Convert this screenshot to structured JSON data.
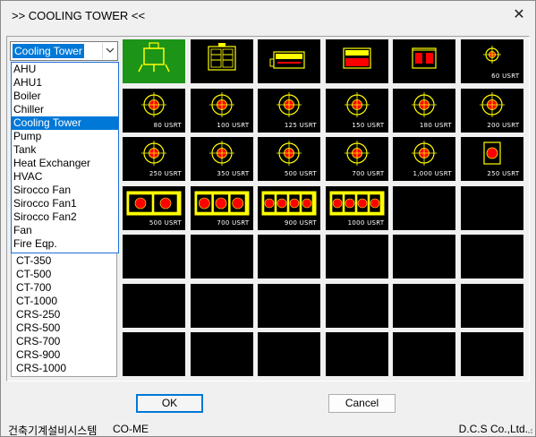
{
  "window": {
    "title": ">> COOLING TOWER <<"
  },
  "combo": {
    "selected": "Cooling Tower"
  },
  "dropdown": {
    "items": [
      "AHU",
      "AHU1",
      "Boiler",
      "Chiller",
      "Cooling Tower",
      "Pump",
      "Tank",
      "Heat Exchanger",
      "HVAC",
      "Sirocco Fan",
      "Sirocco Fan1",
      "Sirocco Fan2",
      "Fan",
      "Fire Eqp."
    ],
    "selected_index": 4
  },
  "list": {
    "items": [
      "CT-350",
      "CT-500",
      "CT-700",
      "CT-1000",
      "CRS-250",
      "CRS-500",
      "CRS-700",
      "CRS-900",
      "CRS-1000"
    ]
  },
  "grid": {
    "rows": [
      [
        {
          "icon": "cooling-tower-top-icon",
          "label": "",
          "highlight": true
        },
        {
          "icon": "cooling-tower-front-icon",
          "label": ""
        },
        {
          "icon": "cooling-tower-side-icon",
          "label": ""
        },
        {
          "icon": "cooling-tower-box-icon",
          "label": ""
        },
        {
          "icon": "cooling-tower-unit-icon",
          "label": ""
        },
        {
          "icon": "round-tower-small-icon",
          "label": "60 USRT"
        }
      ],
      [
        {
          "icon": "round-tower-icon",
          "label": "80 USRT"
        },
        {
          "icon": "round-tower-icon",
          "label": "100 USRT"
        },
        {
          "icon": "round-tower-icon",
          "label": "125 USRT"
        },
        {
          "icon": "round-tower-icon",
          "label": "150 USRT"
        },
        {
          "icon": "round-tower-icon",
          "label": "180 USRT"
        },
        {
          "icon": "round-tower-icon",
          "label": "200 USRT"
        }
      ],
      [
        {
          "icon": "round-tower-icon",
          "label": "250 USRT"
        },
        {
          "icon": "round-tower-icon",
          "label": "350 USRT"
        },
        {
          "icon": "round-tower-icon",
          "label": "500 USRT"
        },
        {
          "icon": "round-tower-icon",
          "label": "700 USRT"
        },
        {
          "icon": "round-tower-icon",
          "label": "1,000 USRT"
        },
        {
          "icon": "square-tower-icon",
          "label": "250 USRT"
        }
      ],
      [
        {
          "icon": "square-tower-multi-icon",
          "label": "500 USRT"
        },
        {
          "icon": "square-tower-multi-icon",
          "label": "700 USRT"
        },
        {
          "icon": "square-tower-multi-icon",
          "label": "900 USRT"
        },
        {
          "icon": "square-tower-multi-icon",
          "label": "1000 USRT"
        },
        {
          "icon": "",
          "label": ""
        },
        {
          "icon": "",
          "label": ""
        }
      ],
      [
        {
          "icon": "",
          "label": ""
        },
        {
          "icon": "",
          "label": ""
        },
        {
          "icon": "",
          "label": ""
        },
        {
          "icon": "",
          "label": ""
        },
        {
          "icon": "",
          "label": ""
        },
        {
          "icon": "",
          "label": ""
        }
      ],
      [
        {
          "icon": "",
          "label": ""
        },
        {
          "icon": "",
          "label": ""
        },
        {
          "icon": "",
          "label": ""
        },
        {
          "icon": "",
          "label": ""
        },
        {
          "icon": "",
          "label": ""
        },
        {
          "icon": "",
          "label": ""
        }
      ],
      [
        {
          "icon": "",
          "label": ""
        },
        {
          "icon": "",
          "label": ""
        },
        {
          "icon": "",
          "label": ""
        },
        {
          "icon": "",
          "label": ""
        },
        {
          "icon": "",
          "label": ""
        },
        {
          "icon": "",
          "label": ""
        }
      ]
    ]
  },
  "buttons": {
    "ok": "OK",
    "cancel": "Cancel"
  },
  "status": {
    "left": "건축기계설비시스템",
    "mid": "CO-ME",
    "right": "D.C.S Co.,Ltd."
  },
  "colors": {
    "accent": "#0078d7",
    "cell_bg": "#000000",
    "highlight_bg": "#1c9418",
    "symbol_yellow": "#ffff00",
    "symbol_red": "#ff0000"
  }
}
